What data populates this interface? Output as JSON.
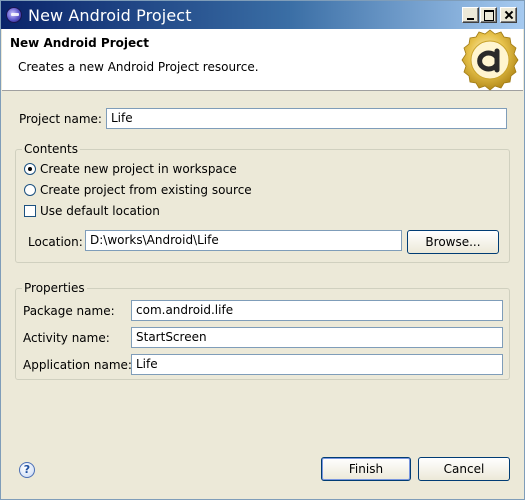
{
  "window": {
    "title": "New Android Project"
  },
  "header": {
    "title": "New Android Project",
    "description": "Creates a new Android Project resource.",
    "logo_icon": "android-logo-icon"
  },
  "project": {
    "name_label": "Project name:",
    "name_value": "Life"
  },
  "contents": {
    "legend": "Contents",
    "options": [
      {
        "label": "Create new project in workspace",
        "selected": true
      },
      {
        "label": "Create project from existing source",
        "selected": false
      }
    ],
    "use_default_label": "Use default location",
    "use_default_checked": false,
    "location_label": "Location:",
    "location_value": "D:\\works\\Android\\Life",
    "browse_label": "Browse..."
  },
  "properties": {
    "legend": "Properties",
    "package_label": "Package name:",
    "package_value": "com.android.life",
    "activity_label": "Activity name:",
    "activity_value": "StartScreen",
    "application_label": "Application name:",
    "application_value": "Life"
  },
  "footer": {
    "help_icon": "help-icon",
    "finish_label": "Finish",
    "cancel_label": "Cancel"
  },
  "colors": {
    "titlebar_start": "#0a246a",
    "titlebar_end": "#a6caf0",
    "dialog_bg": "#ece9d8",
    "logo_gold": "#d8b030"
  }
}
